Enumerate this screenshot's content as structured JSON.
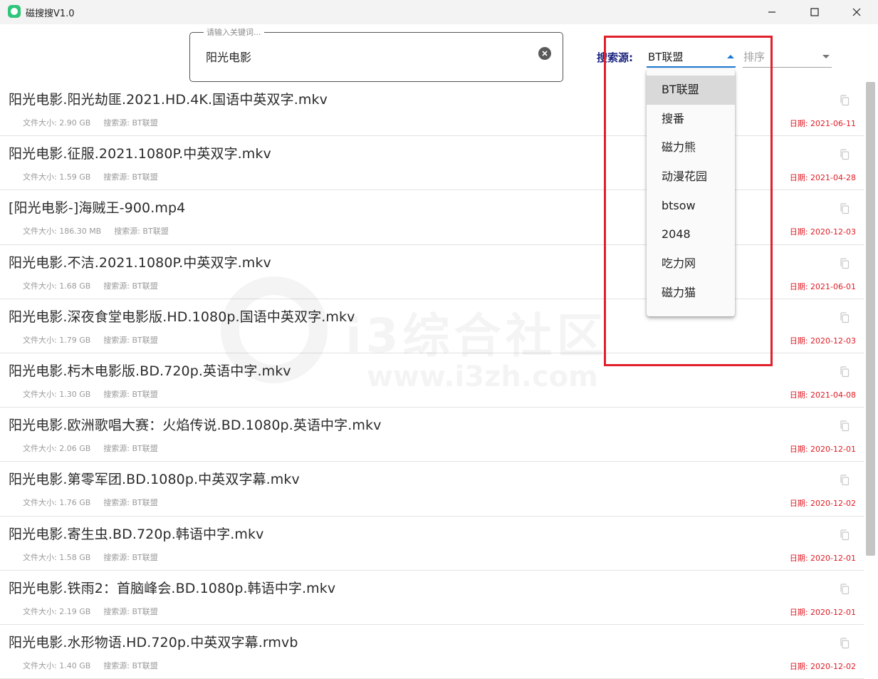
{
  "window": {
    "title": "磁搜搜V1.0",
    "controls": [
      "minimize",
      "maximize",
      "close"
    ]
  },
  "search": {
    "placeholder": "请输入关键词...",
    "value": "阳光电影"
  },
  "source": {
    "label": "搜索源:",
    "selected": "BT联盟",
    "options": [
      "BT联盟",
      "搜番",
      "磁力熊",
      "动漫花园",
      "btsow",
      "2048",
      "吃力网",
      "磁力猫"
    ]
  },
  "sort": {
    "placeholder": "排序"
  },
  "results": [
    {
      "title": "阳光电影.阳光劫匪.2021.HD.4K.国语中英双字.mkv",
      "size": "文件大小: 2.90 GB",
      "source": "搜索源: BT联盟",
      "date": "日期: 2021-06-11"
    },
    {
      "title": "阳光电影.征服.2021.1080P.中英双字.mkv",
      "size": "文件大小: 1.59 GB",
      "source": "搜索源: BT联盟",
      "date": "日期: 2021-04-28"
    },
    {
      "title": "[阳光电影-]海贼王-900.mp4",
      "size": "文件大小: 186.30 MB",
      "source": "搜索源: BT联盟",
      "date": "日期: 2020-12-03"
    },
    {
      "title": "阳光电影.不洁.2021.1080P.中英双字.mkv",
      "size": "文件大小: 1.68 GB",
      "source": "搜索源: BT联盟",
      "date": "日期: 2021-06-01"
    },
    {
      "title": "阳光电影.深夜食堂电影版.HD.1080p.国语中英双字.mkv",
      "size": "文件大小: 1.79 GB",
      "source": "搜索源: BT联盟",
      "date": "日期: 2020-12-03"
    },
    {
      "title": "阳光电影.杇木电影版.BD.720p.英语中字.mkv",
      "size": "文件大小: 1.30 GB",
      "source": "搜索源: BT联盟",
      "date": "日期: 2021-04-08"
    },
    {
      "title": "阳光电影.欧洲歌唱大赛：火焰传说.BD.1080p.英语中字.mkv",
      "size": "文件大小: 2.06 GB",
      "source": "搜索源: BT联盟",
      "date": "日期: 2020-12-01"
    },
    {
      "title": "阳光电影.第零军团.BD.1080p.中英双字幕.mkv",
      "size": "文件大小: 1.76 GB",
      "source": "搜索源: BT联盟",
      "date": "日期: 2020-12-02"
    },
    {
      "title": "阳光电影.寄生虫.BD.720p.韩语中字.mkv",
      "size": "文件大小: 1.58 GB",
      "source": "搜索源: BT联盟",
      "date": "日期: 2020-12-01"
    },
    {
      "title": "阳光电影.铁雨2：首脑峰会.BD.1080p.韩语中字.mkv",
      "size": "文件大小: 2.19 GB",
      "source": "搜索源: BT联盟",
      "date": "日期: 2020-12-01"
    },
    {
      "title": "阳光电影.水形物语.HD.720p.中英双字幕.rmvb",
      "size": "文件大小: 1.40 GB",
      "source": "搜索源: BT联盟",
      "date": "日期: 2020-12-02"
    }
  ],
  "watermark": {
    "text": "i3综合社区",
    "url": "www.i3zh.com"
  },
  "colors": {
    "accent": "#1976d2",
    "source_label": "#1a237e",
    "date": "#e01b24",
    "highlight": "#e0202b"
  },
  "icons": {
    "app": "app-logo-icon",
    "clear": "clear-icon",
    "copy": "copy-icon",
    "dropdown_open": "caret-up-icon",
    "dropdown_closed": "caret-down-icon"
  }
}
